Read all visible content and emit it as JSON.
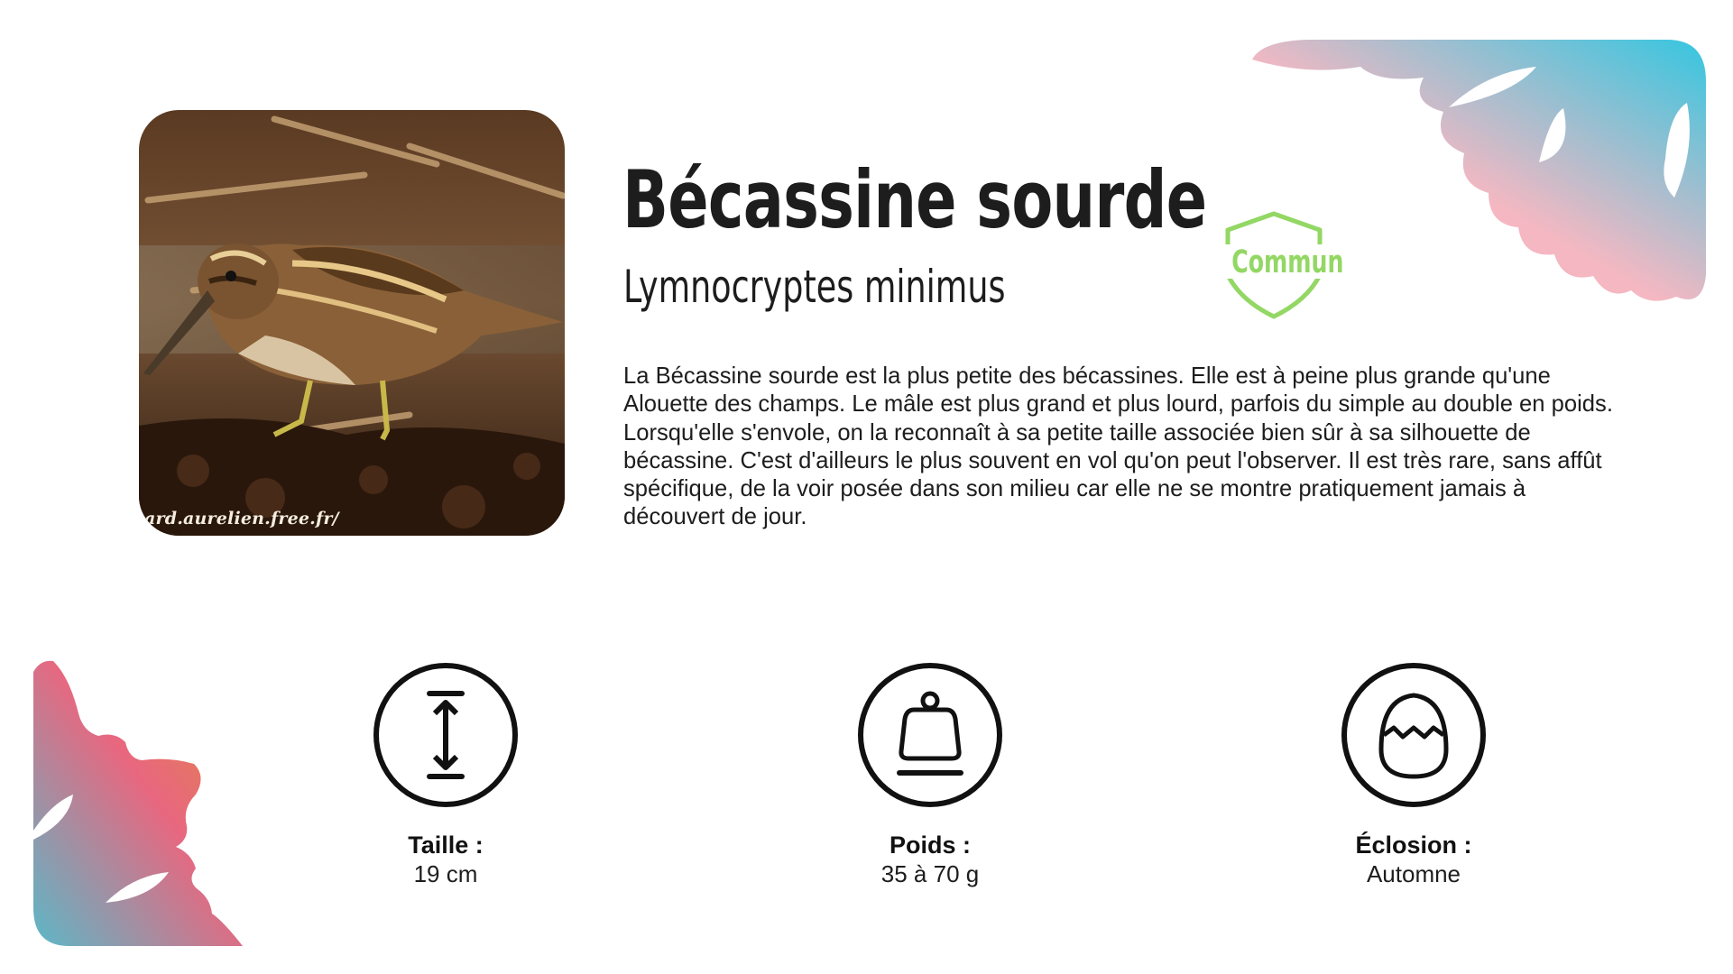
{
  "species": {
    "name": "Bécassine sourde",
    "latin_name": "Lymnocryptes minimus",
    "status": "Commun",
    "photo_credit": "ard.aurelien.free.fr/",
    "description": "La Bécassine sourde est la plus petite des bécassines. Elle est à peine plus grande qu'une Alouette des champs. Le mâle est plus grand et plus lourd, parfois du simple au double en poids. Lorsqu'elle s'envole, on la reconnaît à sa petite taille associée bien sûr à sa silhouette de bécassine. C'est d'ailleurs le plus souvent en vol qu'on peut l'observer. Il est très rare, sans affût spécifique, de la voir posée dans son milieu car elle ne se montre pratiquement jamais à découvert de jour."
  },
  "stats": [
    {
      "label": "Taille :",
      "value": "19 cm",
      "icon": "height-arrow-icon"
    },
    {
      "label": "Poids :",
      "value": "35 à 70 g",
      "icon": "weight-icon"
    },
    {
      "label": "Éclosion :",
      "value": "Automne",
      "icon": "egg-icon"
    }
  ],
  "colors": {
    "status_green": "#93d764",
    "gradient_top": [
      "#f6b9c4",
      "#3cc8e0"
    ],
    "gradient_bottom": [
      "#e08a3a",
      "#e86a85",
      "#5ab8c8"
    ]
  }
}
